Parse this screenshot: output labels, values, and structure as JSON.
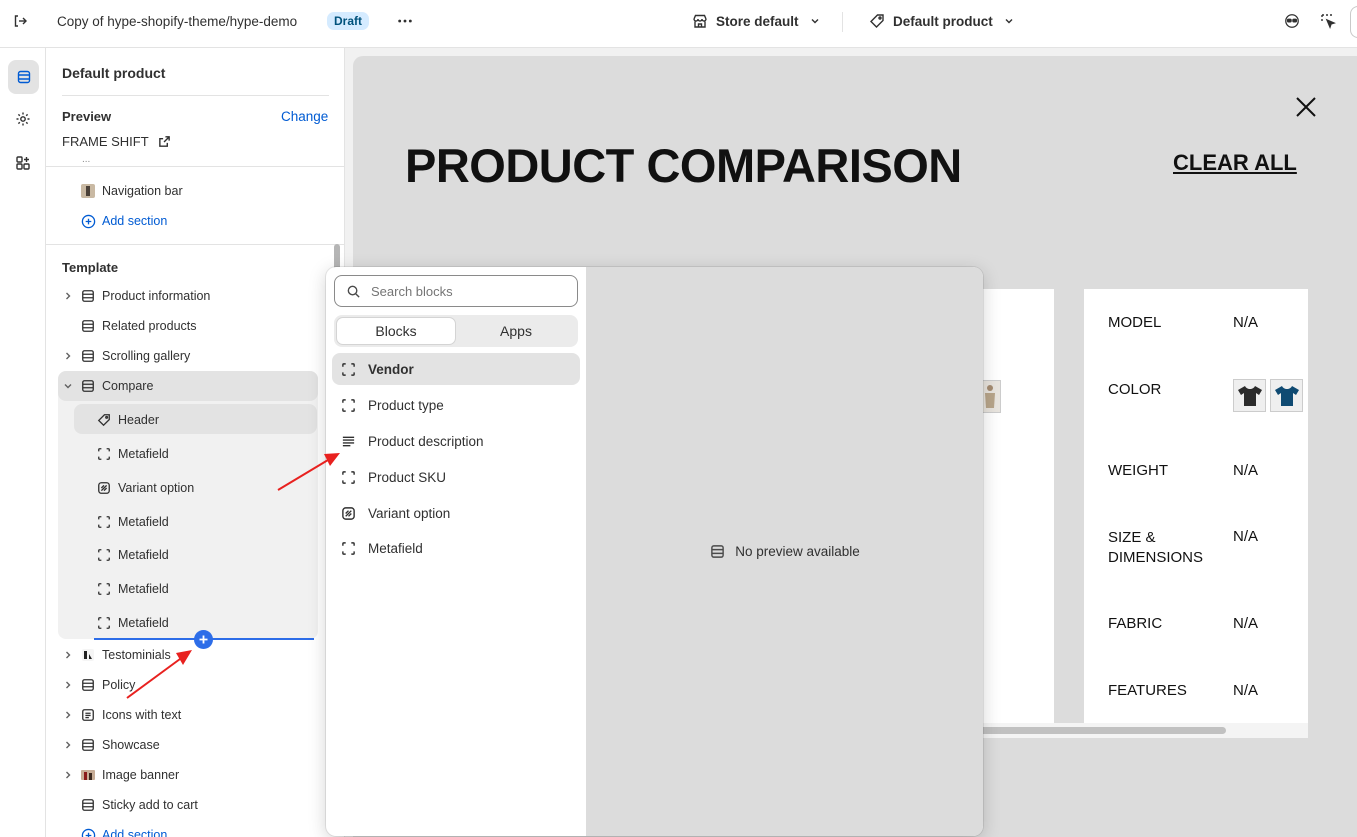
{
  "topbar": {
    "theme_title": "Copy of hype-shopify-theme/hype-demo",
    "status_badge": "Draft",
    "store_selector": "Store default",
    "template_selector": "Default product"
  },
  "sidebar": {
    "page_title": "Default product",
    "preview": {
      "label": "Preview",
      "change_link": "Change",
      "product_name": "FRAME SHIFT"
    },
    "header_group": {
      "partial_item": "...",
      "items": [
        {
          "label": "Navigation bar"
        }
      ],
      "add_section": "Add section"
    },
    "template": {
      "heading": "Template",
      "sections": [
        {
          "label": "Product information"
        },
        {
          "label": "Related products"
        },
        {
          "label": "Scrolling gallery"
        },
        {
          "label": "Compare"
        },
        {
          "label": "Testominials"
        },
        {
          "label": "Policy"
        },
        {
          "label": "Icons with text"
        },
        {
          "label": "Showcase"
        },
        {
          "label": "Image banner"
        },
        {
          "label": "Sticky add to cart"
        }
      ],
      "compare_blocks": [
        {
          "label": "Header"
        },
        {
          "label": "Metafield"
        },
        {
          "label": "Variant option"
        },
        {
          "label": "Metafield"
        },
        {
          "label": "Metafield"
        },
        {
          "label": "Metafield"
        },
        {
          "label": "Metafield"
        }
      ],
      "add_section": "Add section"
    }
  },
  "picker": {
    "search_placeholder": "Search blocks",
    "tabs": [
      {
        "label": "Blocks"
      },
      {
        "label": "Apps"
      }
    ],
    "blocks": [
      {
        "label": "Vendor",
        "icon": "dashed-square-icon"
      },
      {
        "label": "Product type",
        "icon": "dashed-square-icon"
      },
      {
        "label": "Product description",
        "icon": "text-lines-icon"
      },
      {
        "label": "Product SKU",
        "icon": "dashed-square-icon"
      },
      {
        "label": "Variant option",
        "icon": "swatch-icon"
      },
      {
        "label": "Metafield",
        "icon": "dashed-square-icon"
      }
    ],
    "preview_empty": "No preview available"
  },
  "canvas": {
    "heading": "PRODUCT COMPARISON",
    "clear_all": "CLEAR ALL",
    "specs": [
      {
        "label": "MODEL",
        "value": "N/A"
      },
      {
        "label": "COLOR",
        "value": ""
      },
      {
        "label": "WEIGHT",
        "value": "N/A"
      },
      {
        "label": "SIZE & DIMENSIONS",
        "value": "N/A"
      },
      {
        "label": "FABRIC",
        "value": "N/A"
      },
      {
        "label": "FEATURES",
        "value": "N/A"
      }
    ],
    "swatch_colors": [
      "#2b2b2b",
      "#0f4a72"
    ]
  },
  "colors": {
    "accent": "#005bd3",
    "draft_badge_bg": "#d5ebff",
    "canvas_bg": "#dcdcdc",
    "annotation_arrow": "#e8211f",
    "insert_dot": "#2d6de8"
  }
}
